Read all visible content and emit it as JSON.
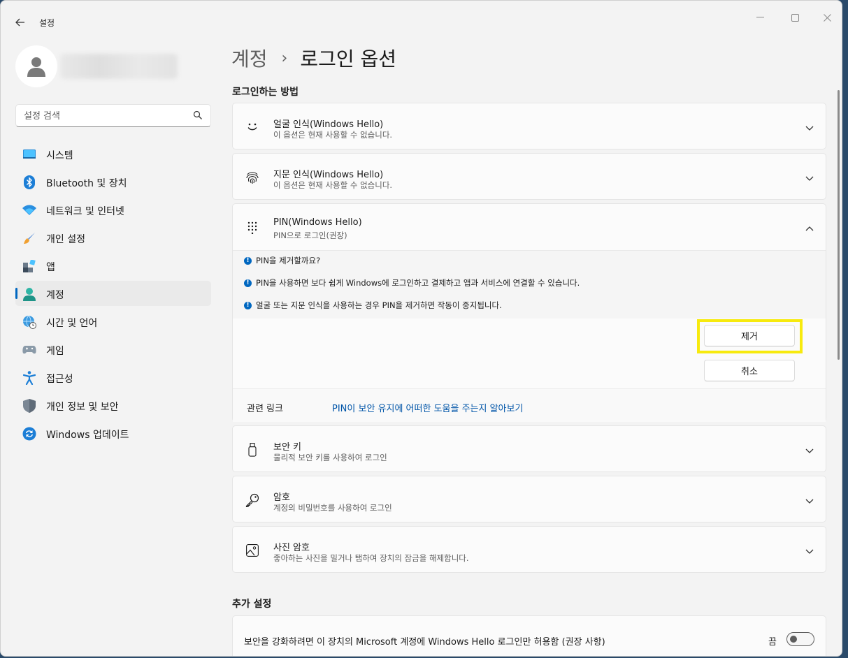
{
  "window": {
    "app_title": "설정",
    "back_icon": "back-arrow-icon",
    "minimize_icon": "minimize-icon",
    "maximize_icon": "maximize-icon",
    "close_icon": "close-icon"
  },
  "sidebar": {
    "search_placeholder": "설정 검색",
    "items": [
      {
        "label": "시스템",
        "icon": "system-monitor-icon"
      },
      {
        "label": "Bluetooth 및 장치",
        "icon": "bluetooth-icon"
      },
      {
        "label": "네트워크 및 인터넷",
        "icon": "wifi-icon"
      },
      {
        "label": "개인 설정",
        "icon": "paintbrush-icon"
      },
      {
        "label": "앱",
        "icon": "apps-icon"
      },
      {
        "label": "계정",
        "icon": "account-icon",
        "active": true
      },
      {
        "label": "시간 및 언어",
        "icon": "globe-clock-icon"
      },
      {
        "label": "게임",
        "icon": "gamepad-icon"
      },
      {
        "label": "접근성",
        "icon": "accessibility-icon"
      },
      {
        "label": "개인 정보 및 보안",
        "icon": "shield-icon"
      },
      {
        "label": "Windows 업데이트",
        "icon": "update-icon"
      }
    ]
  },
  "main": {
    "breadcrumb_parent": "계정",
    "breadcrumb_sep": "›",
    "breadcrumb_current": "로그인 옵션",
    "section_signin": "로그인하는 방법",
    "section_additional": "추가 설정",
    "cards": [
      {
        "title": "얼굴 인식(Windows Hello)",
        "subtitle": "이 옵션은 현재 사용할 수 없습니다.",
        "icon": "face-icon"
      },
      {
        "title": "지문 인식(Windows Hello)",
        "subtitle": "이 옵션은 현재 사용할 수 없습니다.",
        "icon": "fingerprint-icon"
      },
      {
        "title": "PIN(Windows Hello)",
        "subtitle": "PIN으로 로그인(권장)",
        "icon": "pin-keypad-icon"
      },
      {
        "title": "보안 키",
        "subtitle": "물리적 보안 키를 사용하여 로그인",
        "icon": "usb-key-icon"
      },
      {
        "title": "암호",
        "subtitle": "계정의 비밀번호를 사용하여 로그인",
        "icon": "key-icon"
      },
      {
        "title": "사진 암호",
        "subtitle": "좋아하는 사진을 밀거나 탭하여 장치의 잠금을 해제합니다.",
        "icon": "picture-icon"
      }
    ],
    "pin_info": [
      "PIN을 제거할까요?",
      "PIN을 사용하면 보다 쉽게 Windows에 로그인하고 결제하고 앱과 서비스에 연결할 수 있습니다.",
      "얼굴 또는 지문 인식을 사용하는 경우 PIN을 제거하면 작동이 중지됩니다."
    ],
    "remove_button": "제거",
    "cancel_button": "취소",
    "related_label": "관련 링크",
    "related_link": "PIN이 보안 유지에 어떠한 도움을 주는지 알아보기",
    "toggle_label": "보안을 강화하려면 이 장치의 Microsoft 계정에 Windows Hello 로그인만 허용함 (권장 사항)",
    "toggle_state": "끔"
  },
  "colors": {
    "accent": "#0067c0",
    "highlight": "#f7ea0e",
    "link": "#0055a8"
  }
}
